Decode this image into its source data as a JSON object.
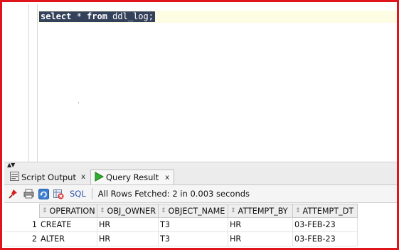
{
  "editor": {
    "query_keyword1": "select",
    "query_middle": " * ",
    "query_keyword2": "from",
    "query_rest": " ddl_log;"
  },
  "tabs": [
    {
      "label": "Script Output",
      "close": "x",
      "icon": "script-output-icon"
    },
    {
      "label": "Query Result",
      "close": "x",
      "icon": "run-triangle-icon"
    }
  ],
  "toolbar": {
    "sql_label": "SQL",
    "status": "All Rows Fetched: 2 in 0.003 seconds"
  },
  "results": {
    "columns": [
      "OPERATION",
      "OBJ_OWNER",
      "OBJECT_NAME",
      "ATTEMPT_BY",
      "ATTEMPT_DT"
    ],
    "rows": [
      {
        "num": "1",
        "cells": [
          "CREATE",
          "HR",
          "T3",
          "HR",
          "03-FEB-23"
        ]
      },
      {
        "num": "2",
        "cells": [
          "ALTER",
          "HR",
          "T3",
          "HR",
          "03-FEB-23"
        ]
      }
    ]
  },
  "colors": {
    "frame_border": "#e0141b",
    "selection_bg": "#33415a",
    "sql_link": "#2a55a8"
  }
}
